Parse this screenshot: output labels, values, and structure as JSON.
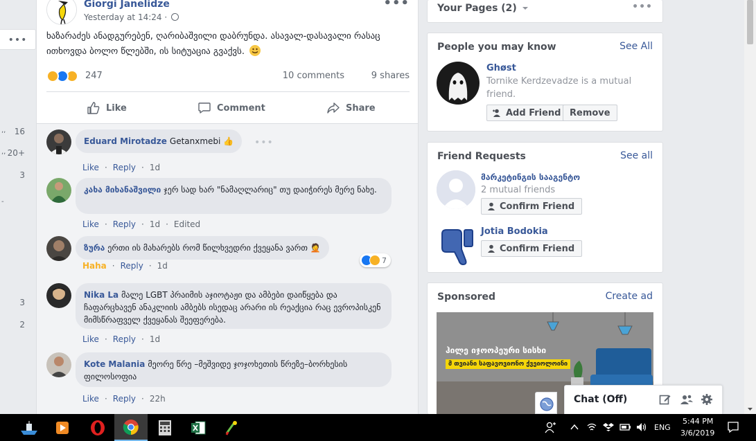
{
  "gutter": {
    "menu_dots": "•••",
    "counts": [
      "16",
      "20+",
      "3",
      "3",
      "2"
    ],
    "marks": [
      ",,",
      ",,",
      "-"
    ]
  },
  "post": {
    "author": "Giorgi Janelidze",
    "time": "Yesterday at 14:24 ·",
    "menu": "•••",
    "text": "ხაზარაძეს ანადგურებენ, ღარიბაშვილი დაბრუნდა. ასავალ-დასავალი რასაც ითხოვდა ბოლო წლებში, ის სიტუაცია გვაქვს.",
    "reaction_count": "247",
    "comments": "10 comments",
    "shares": "9 shares",
    "actions": {
      "like": "Like",
      "comment": "Comment",
      "share": "Share"
    }
  },
  "comments": [
    {
      "name": "Eduard Mirotadze",
      "text": "Getanxmebi 👍",
      "like": "Like",
      "reply": "Reply",
      "time": "1d",
      "edited": "",
      "menu": "•••"
    },
    {
      "name": "კახა მიხანაშვილი",
      "text": "ჯერ სად ხარ \"ნამაღლარიც\" თუ დაიჭირეს მერე ნახე.",
      "like": "Like",
      "reply": "Reply",
      "time": "1d",
      "edited": "Edited",
      "menu": ""
    },
    {
      "name": "ზურა",
      "text": "ერთი ის მახარებს რომ წილხვედრი ქვეყანა ვართ 🤦",
      "like": "Haha",
      "reply": "Reply",
      "time": "1d",
      "edited": "",
      "menu": "",
      "reactions": "7"
    },
    {
      "name": "Nika La",
      "text": "მალე LGBT პრაიმის აჯიოტაჟი და ამბები დაიწყება და ჩაფარცხავენ ანაკლიის ამბებს ისედაც არარი ის რეაქცია რაც ევროპისკენ მიმსწრაფველ ქვეყანას შეეფერება.",
      "like": "Like",
      "reply": "Reply",
      "time": "1d",
      "edited": "",
      "menu": ""
    },
    {
      "name": "Kote Malania",
      "text": "მეორე წრე –მეშვიდე ჯოჯოხეთის წრეზე–ბორხესის ფილოსოფია",
      "like": "Like",
      "reply": "Reply",
      "time": "22h",
      "edited": "",
      "menu": ""
    }
  ],
  "right": {
    "pages": {
      "title": "Your Pages (2)",
      "menu": "•••"
    },
    "pymk": {
      "title": "People you may know",
      "see_all": "See All",
      "name": "Ghøst",
      "sub": "Tornike Kerdzevadze is a mutual friend.",
      "add": "Add Friend",
      "remove": "Remove"
    },
    "requests": {
      "title": "Friend Requests",
      "see_all": "See all",
      "items": [
        {
          "name": "მარკეტინგის სააგენტო",
          "sub": "2 mutual friends",
          "btn": "Confirm Friend"
        },
        {
          "name": "Jotia Bodokia",
          "sub": "",
          "btn": "Confirm Friend"
        }
      ]
    },
    "sponsored": {
      "title": "Sponsored",
      "create_ad": "Create ad",
      "ad_line1": "ჰილე იჯოოპეური სისხი",
      "ad_line2": "მ თვიანი საფავოვიონო ქვეიოლოინი"
    }
  },
  "chat": {
    "label": "Chat (Off)"
  },
  "taskbar": {
    "language": "ENG",
    "time": "5:44 PM",
    "date": "3/6/2019"
  },
  "colors": {
    "fb_blue": "#385898",
    "page_bg": "#e9ebee",
    "taskbar": "#000000",
    "haha": "#f7b125"
  }
}
